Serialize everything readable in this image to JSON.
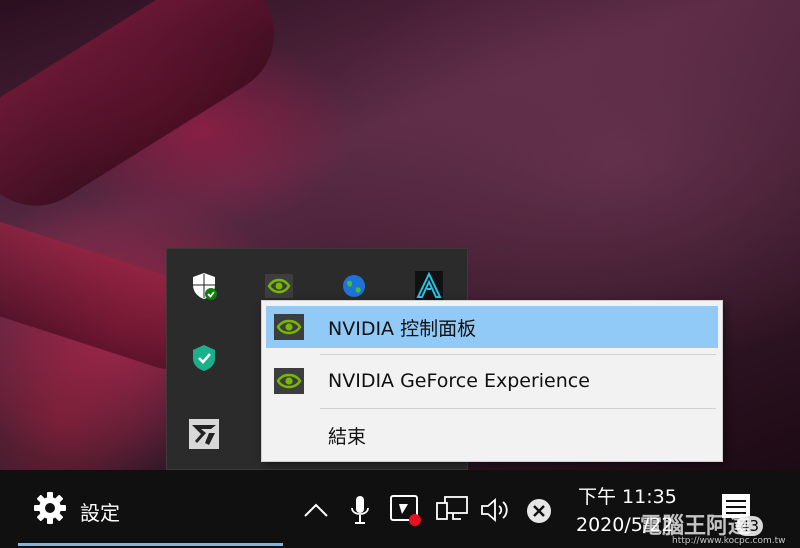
{
  "context_menu": {
    "items": [
      {
        "label": "NVIDIA 控制面板",
        "icon": "nvidia-icon",
        "highlighted": true
      },
      {
        "label": "NVIDIA GeForce Experience",
        "icon": "nvidia-icon",
        "highlighted": false
      },
      {
        "label": "結束",
        "icon": "",
        "highlighted": false
      }
    ]
  },
  "tray_overflow_icons": [
    "windows-security-icon",
    "nvidia-icon",
    "globe-network-icon",
    "audio-software-icon",
    "shield-check-icon",
    "gaming-brand-icon"
  ],
  "taskbar": {
    "settings_label": "設定",
    "icons": [
      "chevron-up-icon",
      "microphone-icon",
      "recording-icon",
      "network-icon",
      "volume-icon",
      "close-circle-icon",
      "notification-icon"
    ],
    "clock": {
      "time": "下午 11:35",
      "date": "2020/5/22"
    },
    "notification_count": "43"
  },
  "watermark": {
    "text": "電腦王阿達",
    "url": "http://www.kocpc.com.tw"
  },
  "colors": {
    "highlight": "#91c9f7",
    "nvidia_green": "#76b900",
    "taskbar": "#101010",
    "menu_bg": "#f2f2f2"
  }
}
